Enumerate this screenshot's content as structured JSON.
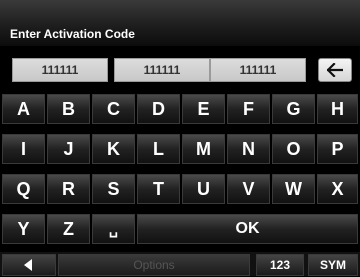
{
  "header": {
    "title": "Enter Activation Code"
  },
  "code_fields": [
    "111111",
    "111111",
    "111111"
  ],
  "backspace_icon": "backspace-arrow-icon",
  "keyboard": {
    "rows": [
      [
        "A",
        "B",
        "C",
        "D",
        "E",
        "F",
        "G",
        "H"
      ],
      [
        "I",
        "J",
        "K",
        "L",
        "M",
        "N",
        "O",
        "P"
      ],
      [
        "Q",
        "R",
        "S",
        "T",
        "U",
        "V",
        "W",
        "X"
      ],
      [
        "Y",
        "Z",
        "␣",
        "OK"
      ]
    ]
  },
  "bottom_bar": {
    "back_icon": "left-triangle-icon",
    "options_label": "Options",
    "numeric_label": "123",
    "symbols_label": "SYM"
  }
}
